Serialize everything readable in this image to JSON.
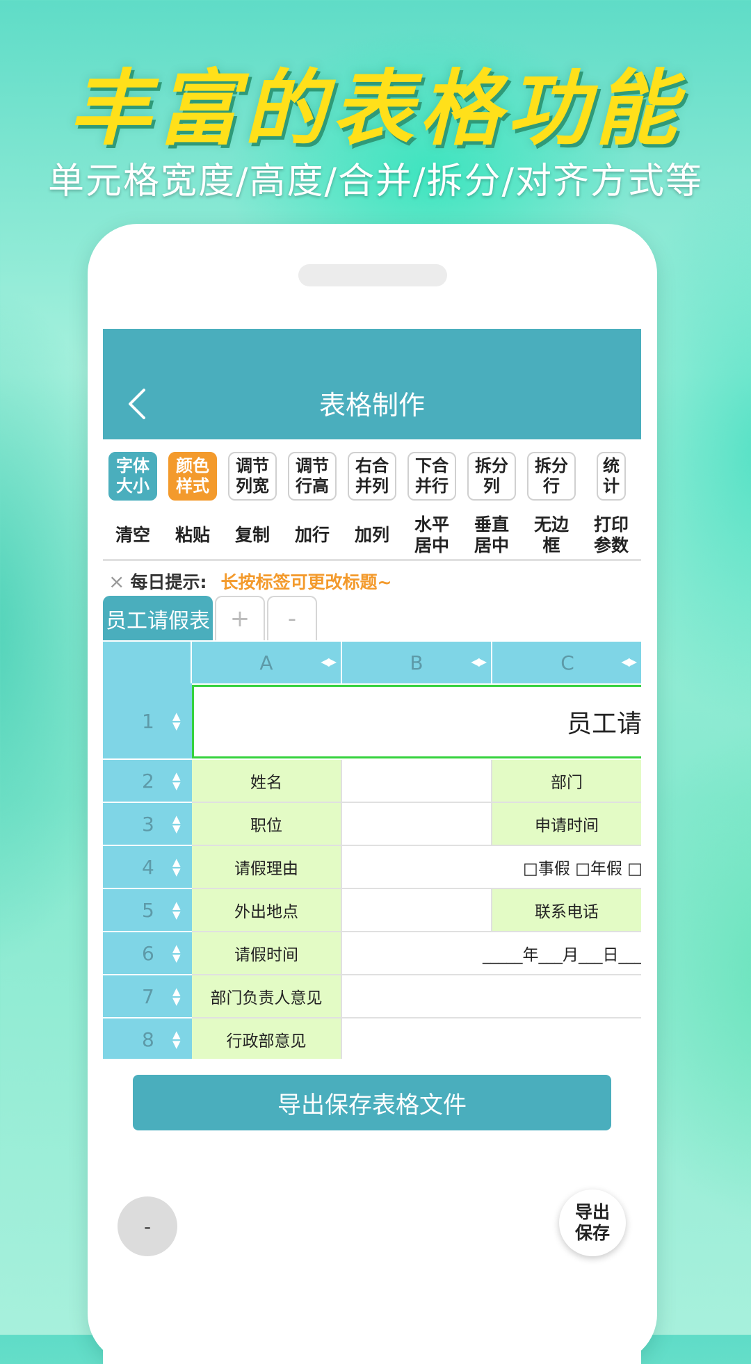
{
  "promo": {
    "headline": "丰富的表格功能",
    "subline": "单元格宽度/高度/合并/拆分/对齐方式等"
  },
  "app": {
    "title": "表格制作",
    "back_icon": "chevron-left-icon",
    "accent_color": "#4aaebd",
    "highlight_color": "#f39a2c"
  },
  "toolbar": {
    "row1": [
      {
        "label": "字体\n大小",
        "state": "active-blue"
      },
      {
        "label": "颜色\n样式",
        "state": "active-orange"
      },
      {
        "label": "调节\n列宽",
        "state": "normal"
      },
      {
        "label": "调节\n行高",
        "state": "normal"
      },
      {
        "label": "右合\n并列",
        "state": "normal"
      },
      {
        "label": "下合\n并行",
        "state": "normal"
      },
      {
        "label": "拆分\n列",
        "state": "normal"
      },
      {
        "label": "拆分\n行",
        "state": "normal"
      },
      {
        "label": "统\n计",
        "state": "narrow"
      }
    ],
    "row2": [
      "清空",
      "粘贴",
      "复制",
      "加行",
      "加列",
      "水平\n居中",
      "垂直\n居中",
      "无边\n框",
      "打印\n参数"
    ]
  },
  "tip": {
    "close": "×",
    "label": "每日提示:",
    "text": "长按标签可更改标题~"
  },
  "tabs": [
    {
      "label": "员工请假表",
      "active": true
    },
    {
      "label": "+",
      "active": false
    },
    {
      "label": "-",
      "active": false
    }
  ],
  "sheet": {
    "columns": [
      "A",
      "B",
      "C"
    ],
    "rows": [
      "1",
      "2",
      "3",
      "4",
      "5",
      "6",
      "7",
      "8"
    ],
    "title_cell": "员工请",
    "cells": {
      "r2": [
        "姓名",
        "",
        "部门"
      ],
      "r3": [
        "职位",
        "",
        "申请时间"
      ],
      "r4": [
        "请假理由",
        "□事假 □年假 □"
      ],
      "r5": [
        "外出地点",
        "",
        "联系电话"
      ],
      "r6": [
        "请假时间",
        "_____年___月___日___"
      ],
      "r7": [
        "部门负责人意见",
        ""
      ],
      "r8": [
        "行政部意见",
        ""
      ]
    }
  },
  "export_button": "导出保存表格文件",
  "fab_minus": "-",
  "fab_save": "导出\n保存"
}
